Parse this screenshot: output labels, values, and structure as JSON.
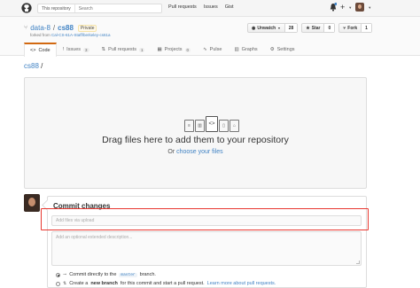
{
  "topbar": {
    "search_scope": "This repository",
    "search_placeholder": "Search",
    "nav": [
      "Pull requests",
      "Issues",
      "Gist"
    ],
    "plus_label": "+"
  },
  "repo": {
    "owner": "data-8",
    "separator": "/",
    "name": "cs88",
    "badge": "Private",
    "forked_prefix": "forked from",
    "forked_repo": "Cal-CS-61A-Staff/berkeley-cs61a",
    "actions": [
      {
        "label": "Unwatch",
        "count": "28"
      },
      {
        "label": "Star",
        "count": "0"
      },
      {
        "label": "Fork",
        "count": "1"
      }
    ],
    "tabs": [
      {
        "label": "Code",
        "icon": "<>",
        "count": ""
      },
      {
        "label": "Issues",
        "icon": "!",
        "count": "3"
      },
      {
        "label": "Pull requests",
        "icon": "⇅",
        "count": "1"
      },
      {
        "label": "Projects",
        "icon": "▦",
        "count": "0"
      },
      {
        "label": "Pulse",
        "icon": "∿",
        "count": ""
      },
      {
        "label": "Graphs",
        "icon": "▥",
        "count": ""
      },
      {
        "label": "Settings",
        "icon": "⚙",
        "count": ""
      }
    ]
  },
  "breadcrumb": {
    "repo": "cs88",
    "sep": "/"
  },
  "dropzone": {
    "title": "Drag files here to add them to your repository",
    "or_text": "Or",
    "choose_link": "choose your files"
  },
  "commit": {
    "title": "Commit changes",
    "summary_placeholder": "Add files via upload",
    "description_placeholder": "Add an optional extended description...",
    "option_direct_prefix": "Commit directly to the",
    "option_direct_branch": "master",
    "option_direct_suffix": "branch.",
    "option_new_prefix": "Create a",
    "option_new_bold": "new branch",
    "option_new_suffix": "for this commit and start a pull request.",
    "option_new_link": "Learn more about pull requests."
  },
  "colors": {
    "link": "#4183c4",
    "highlight": "#e8372f",
    "tab_accent": "#d26911"
  }
}
